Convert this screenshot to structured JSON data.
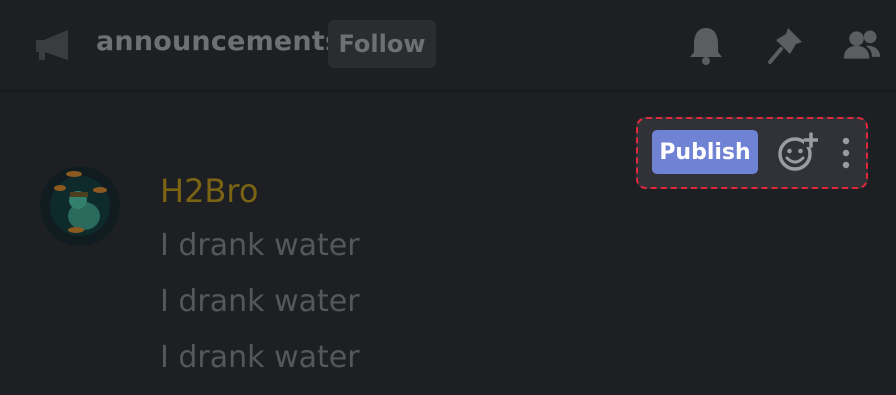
{
  "header": {
    "channel_icon": "megaphone-icon",
    "channel_name": "announcements",
    "follow_label": "Follow",
    "icons": [
      "bell-icon",
      "pin-icon",
      "members-icon"
    ]
  },
  "message": {
    "avatar_icon": "avatar",
    "username": "H2Bro",
    "lines": [
      "I drank water",
      "I drank water",
      "I drank water"
    ]
  },
  "actions": {
    "publish_label": "Publish",
    "react_icon": "add-reaction-icon",
    "more_icon": "more-vertical-icon"
  },
  "colors": {
    "background": "#1e1f22",
    "accent": "#7082d4",
    "username": "#7a6414",
    "highlight_border": "#e0283a"
  }
}
